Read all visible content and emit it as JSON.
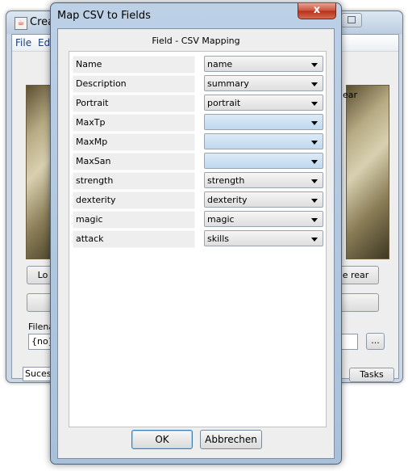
{
  "background_window": {
    "title": "Crea",
    "menu": [
      "File",
      "Edi"
    ],
    "rear_label": "ear",
    "left_button_label": "Lo",
    "rear_button_label": "e rear",
    "filename_label": "Filenam",
    "filename_value": "{no}.p",
    "browse_label": "...",
    "status_text": "Sucessfu",
    "tasks_label": "Tasks"
  },
  "dialog": {
    "title": "Map CSV to Fields",
    "close_label": "x",
    "header": "Field - CSV Mapping",
    "mappings": [
      {
        "field": "Name",
        "csv": "name"
      },
      {
        "field": "Description",
        "csv": "summary"
      },
      {
        "field": "Portrait",
        "csv": "portrait"
      },
      {
        "field": "MaxTp",
        "csv": ""
      },
      {
        "field": "MaxMp",
        "csv": ""
      },
      {
        "field": "MaxSan",
        "csv": ""
      },
      {
        "field": "strength",
        "csv": "strength"
      },
      {
        "field": "dexterity",
        "csv": "dexterity"
      },
      {
        "field": "magic",
        "csv": "magic"
      },
      {
        "field": "attack",
        "csv": "skills"
      }
    ],
    "ok_label": "OK",
    "cancel_label": "Abbrechen"
  }
}
